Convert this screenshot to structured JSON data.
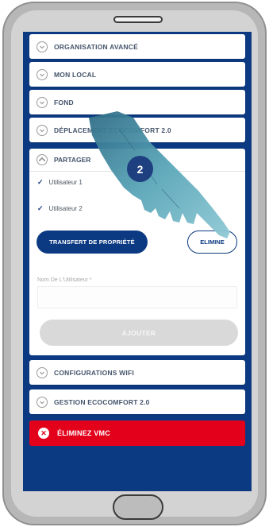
{
  "accordion": {
    "items_top": [
      {
        "label": "ORGANISATION AVANCÉ"
      },
      {
        "label": "MON LOCAL"
      },
      {
        "label": "FOND"
      },
      {
        "label": "DÉPLACEMENT ECOCOMFORT 2.0"
      }
    ],
    "share": {
      "label": "PARTAGER",
      "users": [
        {
          "label": "Utilisateur 1"
        },
        {
          "label": "Utilisateur 2"
        }
      ],
      "transfer_button": "TRANSFERT DE PROPRIÉTÉ",
      "eliminate_button": "ELIMINE",
      "user_name_label": "Nom De L'Utilisateur *",
      "user_name_value": "",
      "add_button": "AJOUTER"
    },
    "items_bottom": [
      {
        "label": "CONFIGURATIONS WIFI"
      },
      {
        "label": "GESTION ECOCOMFORT 2.0"
      }
    ],
    "remove_vmc": {
      "label": "ÉLIMINEZ VMC",
      "icon": "x-icon"
    }
  },
  "step_badge": "2",
  "colors": {
    "primary": "#0c3a82",
    "danger": "#e2001a",
    "disabled": "#d9d9d9",
    "hand": "#4a8fa3"
  }
}
